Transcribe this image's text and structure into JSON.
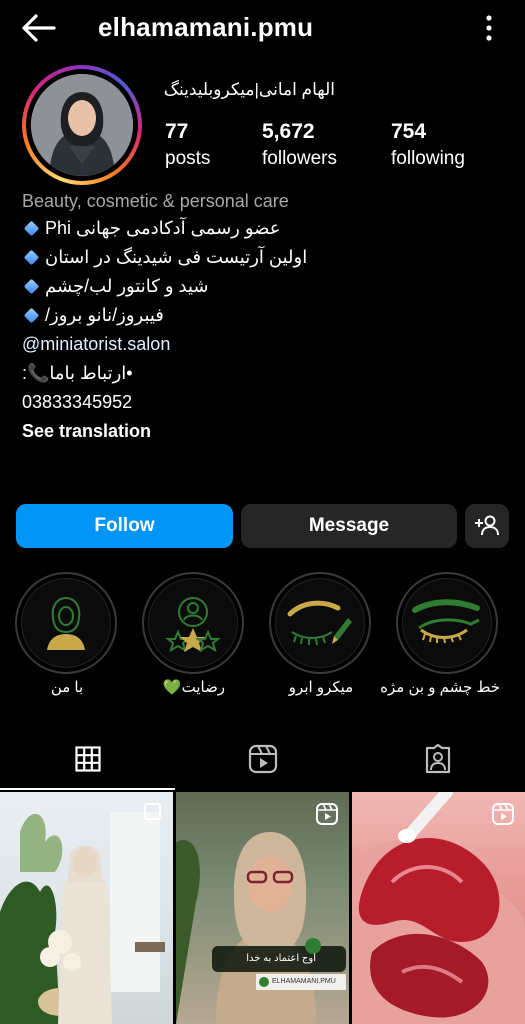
{
  "header": {
    "username": "elhamamani.pmu"
  },
  "profile": {
    "display_name": "الهام امانی|میکروبلیدینگ",
    "stats": [
      {
        "value": "77",
        "label": "posts"
      },
      {
        "value": "5,672",
        "label": "followers"
      },
      {
        "value": "754",
        "label": "following"
      }
    ]
  },
  "bio": {
    "category": "Beauty, cosmetic & personal care",
    "lines": [
      "عضو رسمی آدکادمی جهانی Phi",
      "اولین آرتیست فی شیدینگ در استان",
      "شید و کانتور لب/چشم",
      "فیبروز/نانو بروز/"
    ],
    "link": "@miniatorist.salon",
    "contact_label": "•ارتباط باما📞:",
    "phone": "03833345952",
    "see_translation": "See translation"
  },
  "buttons": {
    "follow": "Follow",
    "message": "Message"
  },
  "highlights": [
    {
      "label": "با من"
    },
    {
      "label": "رضایت💚"
    },
    {
      "label": "میکرو ابرو"
    },
    {
      "label": "خط چشم و بن مژه"
    }
  ],
  "posts": [
    {
      "type": "image"
    },
    {
      "type": "reel",
      "caption": "اوج اعتماد به خدا",
      "handle": "ELHAMAMANI.PMU"
    },
    {
      "type": "reel"
    }
  ],
  "colors": {
    "follow": "#0095f6",
    "secondary_button": "#262626",
    "highlight_icon": "#c9a84a",
    "highlight_green": "#2e7d32"
  }
}
